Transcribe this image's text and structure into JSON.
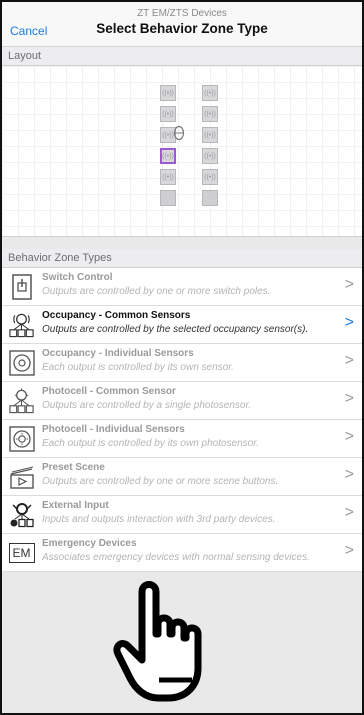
{
  "nav": {
    "subtitle": "ZT EM/ZTS Devices",
    "title": "Select Behavior Zone Type",
    "cancel": "Cancel"
  },
  "sections": {
    "layout": "Layout",
    "types": "Behavior Zone Types"
  },
  "layout_icon": "wireless-sensor-icon",
  "zone_types": [
    {
      "title": "Switch Control",
      "desc": "Outputs are controlled by one or more switch poles.",
      "icon": "switch-icon",
      "active": false
    },
    {
      "title": "Occupancy - Common Sensors",
      "desc": "Outputs are controlled by the selected occupancy sensor(s).",
      "icon": "occupancy-common-icon",
      "active": true
    },
    {
      "title": "Occupancy - Individual Sensors",
      "desc": "Each output is controlled by its own sensor.",
      "icon": "occupancy-individual-icon",
      "active": false
    },
    {
      "title": "Photocell - Common Sensor",
      "desc": "Outputs are controlled by a single photosensor.",
      "icon": "photocell-common-icon",
      "active": false
    },
    {
      "title": "Photocell - Individual Sensors",
      "desc": "Each output is controlled by its own photosensor.",
      "icon": "photocell-individual-icon",
      "active": false
    },
    {
      "title": "Preset Scene",
      "desc": "Outputs are controlled by one or more scene buttons.",
      "icon": "preset-scene-icon",
      "active": false
    },
    {
      "title": "External Input",
      "desc": "Inputs and outputs interaction with 3rd party devices.",
      "icon": "external-input-icon",
      "active": false
    },
    {
      "title": "Emergency Devices",
      "desc": "Associates emergency devices with normal sensing devices.",
      "icon": "em-icon",
      "icon_text": "EM",
      "active": false
    }
  ],
  "colors": {
    "accent": "#1f7ad6",
    "selected_slot": "#9b59d0"
  }
}
